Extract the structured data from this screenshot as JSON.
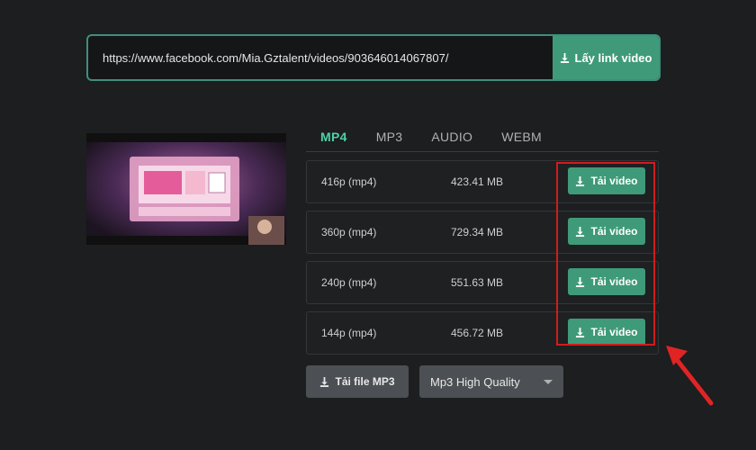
{
  "url_bar": {
    "value": "https://www.facebook.com/Mia.Gztalent/videos/903646014067807/",
    "button_label": "Lấy link video"
  },
  "tabs": [
    {
      "label": "MP4",
      "active": true
    },
    {
      "label": "MP3",
      "active": false
    },
    {
      "label": "AUDIO",
      "active": false
    },
    {
      "label": "WEBM",
      "active": false
    }
  ],
  "downloads": [
    {
      "resolution": "416p (mp4)",
      "size": "423.41 MB",
      "button_label": "Tải video"
    },
    {
      "resolution": "360p (mp4)",
      "size": "729.34 MB",
      "button_label": "Tải video"
    },
    {
      "resolution": "240p (mp4)",
      "size": "551.63 MB",
      "button_label": "Tải video"
    },
    {
      "resolution": "144p (mp4)",
      "size": "456.72 MB",
      "button_label": "Tải video"
    }
  ],
  "mp3": {
    "button_label": "Tải file MP3",
    "quality_selected": "Mp3 High Quality"
  },
  "colors": {
    "accent": "#3f9a79",
    "active_tab": "#4fd1a5",
    "highlight": "#d01c1c"
  }
}
